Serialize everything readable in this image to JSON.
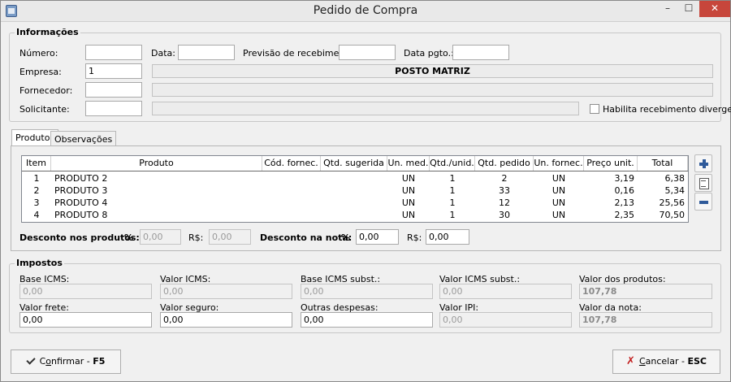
{
  "window": {
    "title": "Pedido de Compra"
  },
  "informacoes": {
    "title": "Informações",
    "numero_label": "Número:",
    "numero_value": "",
    "data_label": "Data:",
    "data_value": "",
    "previsao_label": "Previsão de recebimento:",
    "previsao_value": "",
    "data_pgto_label": "Data pgto.:",
    "data_pgto_value": "",
    "empresa_label": "Empresa:",
    "empresa_code": "1",
    "empresa_name": "POSTO MATRIZ",
    "fornecedor_label": "Fornecedor:",
    "fornecedor_code": "",
    "fornecedor_name": "",
    "solicitante_label": "Solicitante:",
    "solicitante_code": "",
    "solicitante_name": "",
    "habilita_label": "Habilita recebimento divergente",
    "habilita_checked": false
  },
  "tabs": [
    {
      "label": "Produtos",
      "active": true
    },
    {
      "label": "Observações",
      "active": false
    }
  ],
  "grid": {
    "columns": [
      "Item",
      "Produto",
      "Cód. fornec.",
      "Qtd. sugerida",
      "Un. med.",
      "Qtd./unid.",
      "Qtd. pedido",
      "Un. fornec.",
      "Preço unit.",
      "Total"
    ],
    "rows": [
      {
        "item": "1",
        "produto": "PRODUTO 2",
        "cod": "",
        "sugerida": "",
        "un_med": "UN",
        "qtd_unid": "1",
        "pedido": "2",
        "un_fornec": "UN",
        "preco": "3,19",
        "total": "6,38"
      },
      {
        "item": "2",
        "produto": "PRODUTO 3",
        "cod": "",
        "sugerida": "",
        "un_med": "UN",
        "qtd_unid": "1",
        "pedido": "33",
        "un_fornec": "UN",
        "preco": "0,16",
        "total": "5,34"
      },
      {
        "item": "3",
        "produto": "PRODUTO 4",
        "cod": "",
        "sugerida": "",
        "un_med": "UN",
        "qtd_unid": "1",
        "pedido": "12",
        "un_fornec": "UN",
        "preco": "2,13",
        "total": "25,56"
      },
      {
        "item": "4",
        "produto": "PRODUTO 8",
        "cod": "",
        "sugerida": "",
        "un_med": "UN",
        "qtd_unid": "1",
        "pedido": "30",
        "un_fornec": "UN",
        "preco": "2,35",
        "total": "70,50"
      }
    ]
  },
  "descontos": {
    "produtos_label": "Desconto nos produtos:",
    "pct_symbol": "%",
    "produtos_pct": "0,00",
    "rs_label": "R$:",
    "produtos_rs": "0,00",
    "nota_label": "Desconto na nota:",
    "nota_pct": "0,00",
    "nota_rs": "0,00"
  },
  "impostos": {
    "title": "Impostos",
    "base_icms_label": "Base ICMS:",
    "base_icms": "0,00",
    "valor_icms_label": "Valor ICMS:",
    "valor_icms": "0,00",
    "base_subst_label": "Base ICMS subst.:",
    "base_subst": "0,00",
    "valor_subst_label": "Valor ICMS subst.:",
    "valor_subst": "0,00",
    "valor_produtos_label": "Valor dos produtos:",
    "valor_produtos": "107,78",
    "frete_label": "Valor frete:",
    "frete": "0,00",
    "seguro_label": "Valor seguro:",
    "seguro": "0,00",
    "outras_label": "Outras despesas:",
    "outras": "0,00",
    "ipi_label": "Valor IPI:",
    "ipi": "0,00",
    "valor_nota_label": "Valor da nota:",
    "valor_nota": "107,78"
  },
  "footer": {
    "confirmar_pre": "C",
    "confirmar_u": "o",
    "confirmar_post": "nfirmar - ",
    "confirmar_key": "F5",
    "cancelar_u": "C",
    "cancelar_post": "ancelar - ",
    "cancelar_key": "ESC"
  }
}
